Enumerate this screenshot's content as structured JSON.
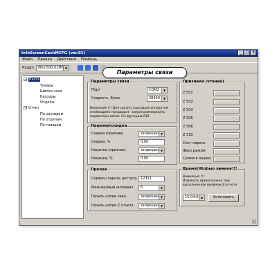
{
  "window": {
    "title": "InfoScreenCashMCFG (ver.01)",
    "minimize": "_",
    "maximize": "□",
    "close": "×"
  },
  "menu": [
    "Файл",
    "Правка",
    "Действия",
    "Помощь"
  ],
  "toolbar": {
    "plugin_label": "Plugin",
    "plugin_value": "Mini-500.01ME"
  },
  "callout": "Параметры связи",
  "tree": {
    "root1": "Касса",
    "children1": [
      "Товары",
      "Шапка чека",
      "Кассиры",
      "Отделы"
    ],
    "root2": "Отчет",
    "children2": [
      "По кассирам",
      "По отделам",
      "По товарам"
    ]
  },
  "connection": {
    "title": "Параметры связи",
    "port_label": "Порт",
    "port_value": "COM2",
    "speed_label": "Скорость, б/сек",
    "speed_value": "38400",
    "note": [
      "Внимание !!! Для связи с кассовым аппаратом",
      "необходимо  предварит.  запрограммировать",
      "параметры связи. См функцию 618"
    ]
  },
  "discounts": {
    "title": "Наценки\\скидки",
    "rows": [
      {
        "label": "Скидка (признак)",
        "value": "запрещена"
      },
      {
        "label": "Скидка, %",
        "value": "0,00"
      },
      {
        "label": "Наценка (признак)",
        "value": "запрещена"
      },
      {
        "label": "Наценка, %",
        "value": "0,00"
      }
    ]
  },
  "other": {
    "title": "Прочее",
    "rows": [
      {
        "label": "Сервисн.пароль доступа",
        "value": "12321"
      },
      {
        "label": "Межчековый интервал",
        "value": "5"
      },
      {
        "label": "Печать копии чека",
        "value": "запрещена"
      },
      {
        "label": "Печать копии Z отчета",
        "value": "запрещена"
      }
    ]
  },
  "signs": {
    "title": "Признаки (чтение)",
    "items": [
      "Z 501",
      "Z 502",
      "Z 503",
      "Z 505",
      "Z 506",
      "Z 510",
      "Сист.пароль",
      "Фиск.режим",
      "Сумма в ящике"
    ]
  },
  "time": {
    "title": "Время(Htobыo эимеее!!!",
    "note": [
      "Внимание !!!",
      "Изменить время можно при",
      "выполненном дневном Z-отчете."
    ],
    "value": "15:04:05",
    "button": "Установить"
  },
  "icons": {
    "tool_colors": [
      "#3a6fd8",
      "#3a6fd8",
      "#2f5fc0",
      "#b8b8b8",
      "#c8c8c8"
    ]
  }
}
